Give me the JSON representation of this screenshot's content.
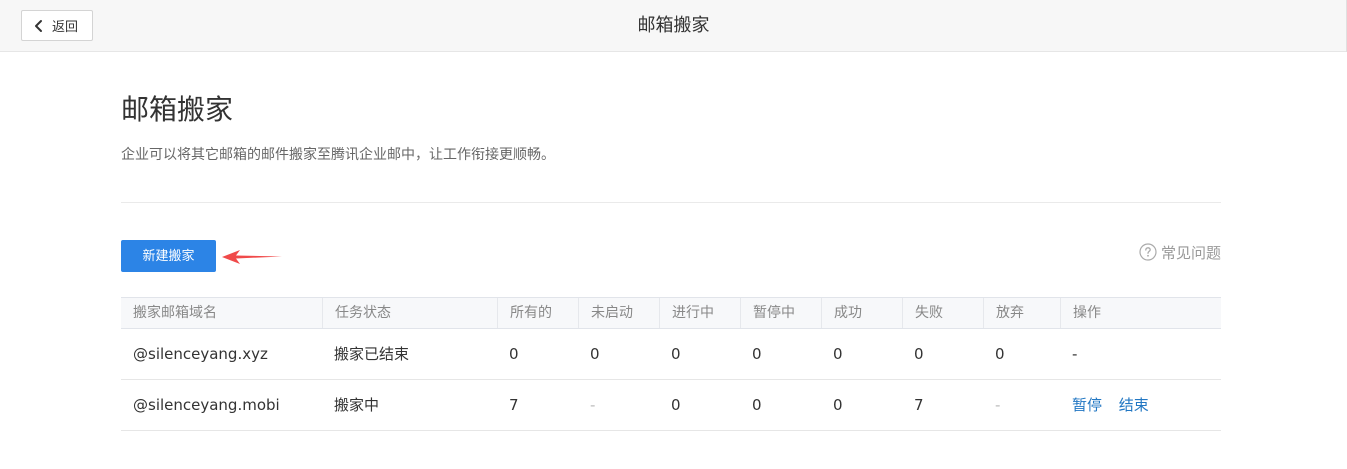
{
  "header": {
    "back_label": "返回",
    "back_icon": "chevron-left-icon",
    "title": "邮箱搬家"
  },
  "main": {
    "heading": "邮箱搬家",
    "description": "企业可以将其它邮箱的邮件搬家至腾讯企业邮中，让工作衔接更顺畅。",
    "new_button_label": "新建搬家",
    "faq_label": "常见问题",
    "faq_icon": "question-circle-icon",
    "annotation_arrow_color": "#f04a4a"
  },
  "colors": {
    "primary": "#2c84e6",
    "link": "#2277c3"
  },
  "table": {
    "columns": [
      "搬家邮箱域名",
      "任务状态",
      "所有的",
      "未启动",
      "进行中",
      "暂停中",
      "成功",
      "失败",
      "放弃",
      "操作"
    ],
    "rows": [
      {
        "domain": "@silenceyang.xyz",
        "status": "搬家已结束",
        "all": "0",
        "not_started": "0",
        "in_progress": "0",
        "paused": "0",
        "success": "0",
        "failed": "0",
        "abandoned": "0",
        "action_text": "-"
      },
      {
        "domain": "@silenceyang.mobi",
        "status": "搬家中",
        "all": "7",
        "not_started": "-",
        "in_progress": "0",
        "paused": "0",
        "success": "0",
        "failed": "7",
        "abandoned": "-",
        "action_pause": "暂停",
        "action_end": "结束"
      }
    ]
  }
}
